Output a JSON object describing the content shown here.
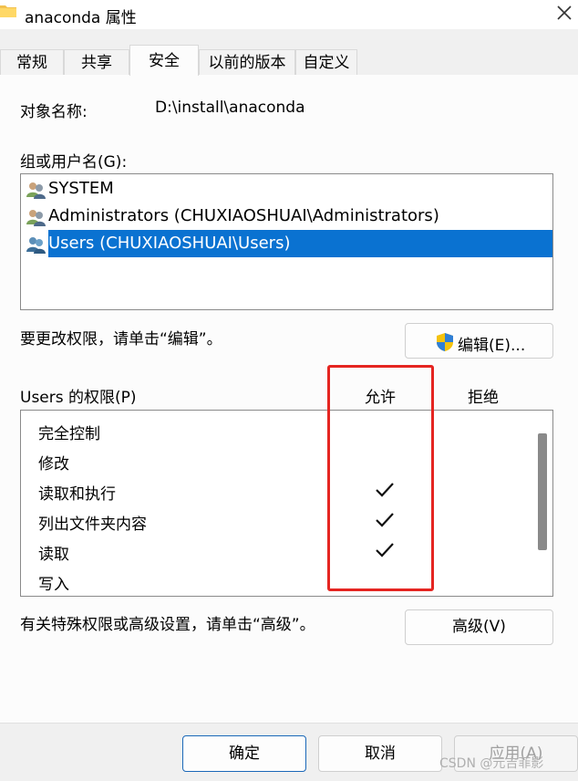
{
  "window": {
    "title": "anaconda 属性"
  },
  "tabs": [
    "常规",
    "共享",
    "安全",
    "以前的版本",
    "自定义"
  ],
  "object": {
    "label": "对象名称:",
    "value": "D:\\install\\anaconda"
  },
  "groups": {
    "label": "组或用户名(G):",
    "items": [
      {
        "name": "SYSTEM",
        "selected": false
      },
      {
        "name": "Administrators (CHUXIAOSHUAI\\Administrators)",
        "selected": false
      },
      {
        "name": "Users (CHUXIAOSHUAI\\Users)",
        "selected": true
      }
    ]
  },
  "edit": {
    "hint": "要更改权限，请单击“编辑”。",
    "button": "编辑(E)..."
  },
  "permissions": {
    "label": "Users 的权限(P)",
    "allow_header": "允许",
    "deny_header": "拒绝",
    "items": [
      {
        "name": "完全控制",
        "allow": false,
        "deny": false
      },
      {
        "name": "修改",
        "allow": false,
        "deny": false
      },
      {
        "name": "读取和执行",
        "allow": true,
        "deny": false
      },
      {
        "name": "列出文件夹内容",
        "allow": true,
        "deny": false
      },
      {
        "name": "读取",
        "allow": true,
        "deny": false
      },
      {
        "name": "写入",
        "allow": false,
        "deny": false
      }
    ]
  },
  "advanced": {
    "hint": "有关特殊权限或高级设置，请单击“高级”。",
    "button": "高级(V)"
  },
  "footer": {
    "ok": "确定",
    "cancel": "取消",
    "apply": "应用(A)"
  },
  "watermark": "CSDN @元吉菲影",
  "colors": {
    "selection": "#0a72d1",
    "highlight": "#e52521",
    "primary_border": "#1a68b8"
  }
}
